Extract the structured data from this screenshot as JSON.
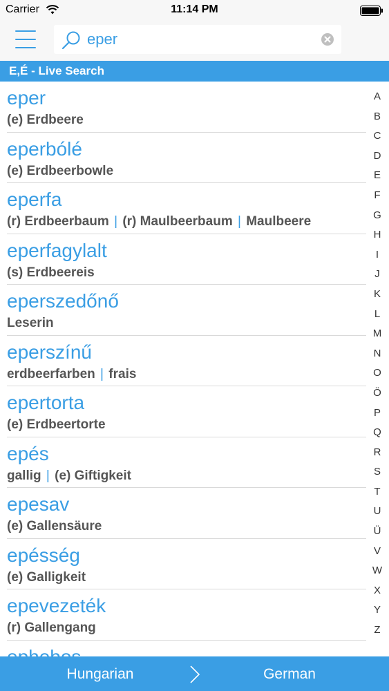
{
  "status_bar": {
    "carrier": "Carrier",
    "time": "11:14 PM"
  },
  "search": {
    "value": "eper",
    "placeholder": ""
  },
  "section_header": "E,É - Live Search",
  "results": [
    {
      "word": "eper",
      "translations": [
        "(e) Erdbeere"
      ]
    },
    {
      "word": "eperbólé",
      "translations": [
        "(e) Erdbeerbowle"
      ]
    },
    {
      "word": "eperfa",
      "translations": [
        "(r) Erdbeerbaum",
        "(r) Maulbeerbaum",
        "Maulbeere"
      ]
    },
    {
      "word": "eperfagylalt",
      "translations": [
        "(s) Erdbeereis"
      ]
    },
    {
      "word": "eperszedőnő",
      "translations": [
        "Leserin"
      ]
    },
    {
      "word": "eperszínű",
      "translations": [
        "erdbeerfarben",
        "frais"
      ]
    },
    {
      "word": "epertorta",
      "translations": [
        "(e) Erdbeertorte"
      ]
    },
    {
      "word": "epés",
      "translations": [
        "gallig",
        "(e) Giftigkeit"
      ]
    },
    {
      "word": "epesav",
      "translations": [
        "(e) Gallensäure"
      ]
    },
    {
      "word": "epésség",
      "translations": [
        "(e) Galligkeit"
      ]
    },
    {
      "word": "epevezeték",
      "translations": [
        "(r) Gallengang"
      ]
    },
    {
      "word": "ephebos",
      "translations": []
    }
  ],
  "alphabet_index": [
    "A",
    "B",
    "C",
    "D",
    "E",
    "F",
    "G",
    "H",
    "I",
    "J",
    "K",
    "L",
    "M",
    "N",
    "O",
    "Ö",
    "P",
    "Q",
    "R",
    "S",
    "T",
    "U",
    "Ü",
    "V",
    "W",
    "X",
    "Y",
    "Z"
  ],
  "language_bar": {
    "source": "Hungarian",
    "target": "German"
  },
  "colors": {
    "accent": "#3a9ee4",
    "translation_text": "#555555"
  },
  "icons": [
    "wifi-icon",
    "battery-icon",
    "menu-icon",
    "search-icon",
    "clear-icon",
    "chevron-right-icon"
  ]
}
